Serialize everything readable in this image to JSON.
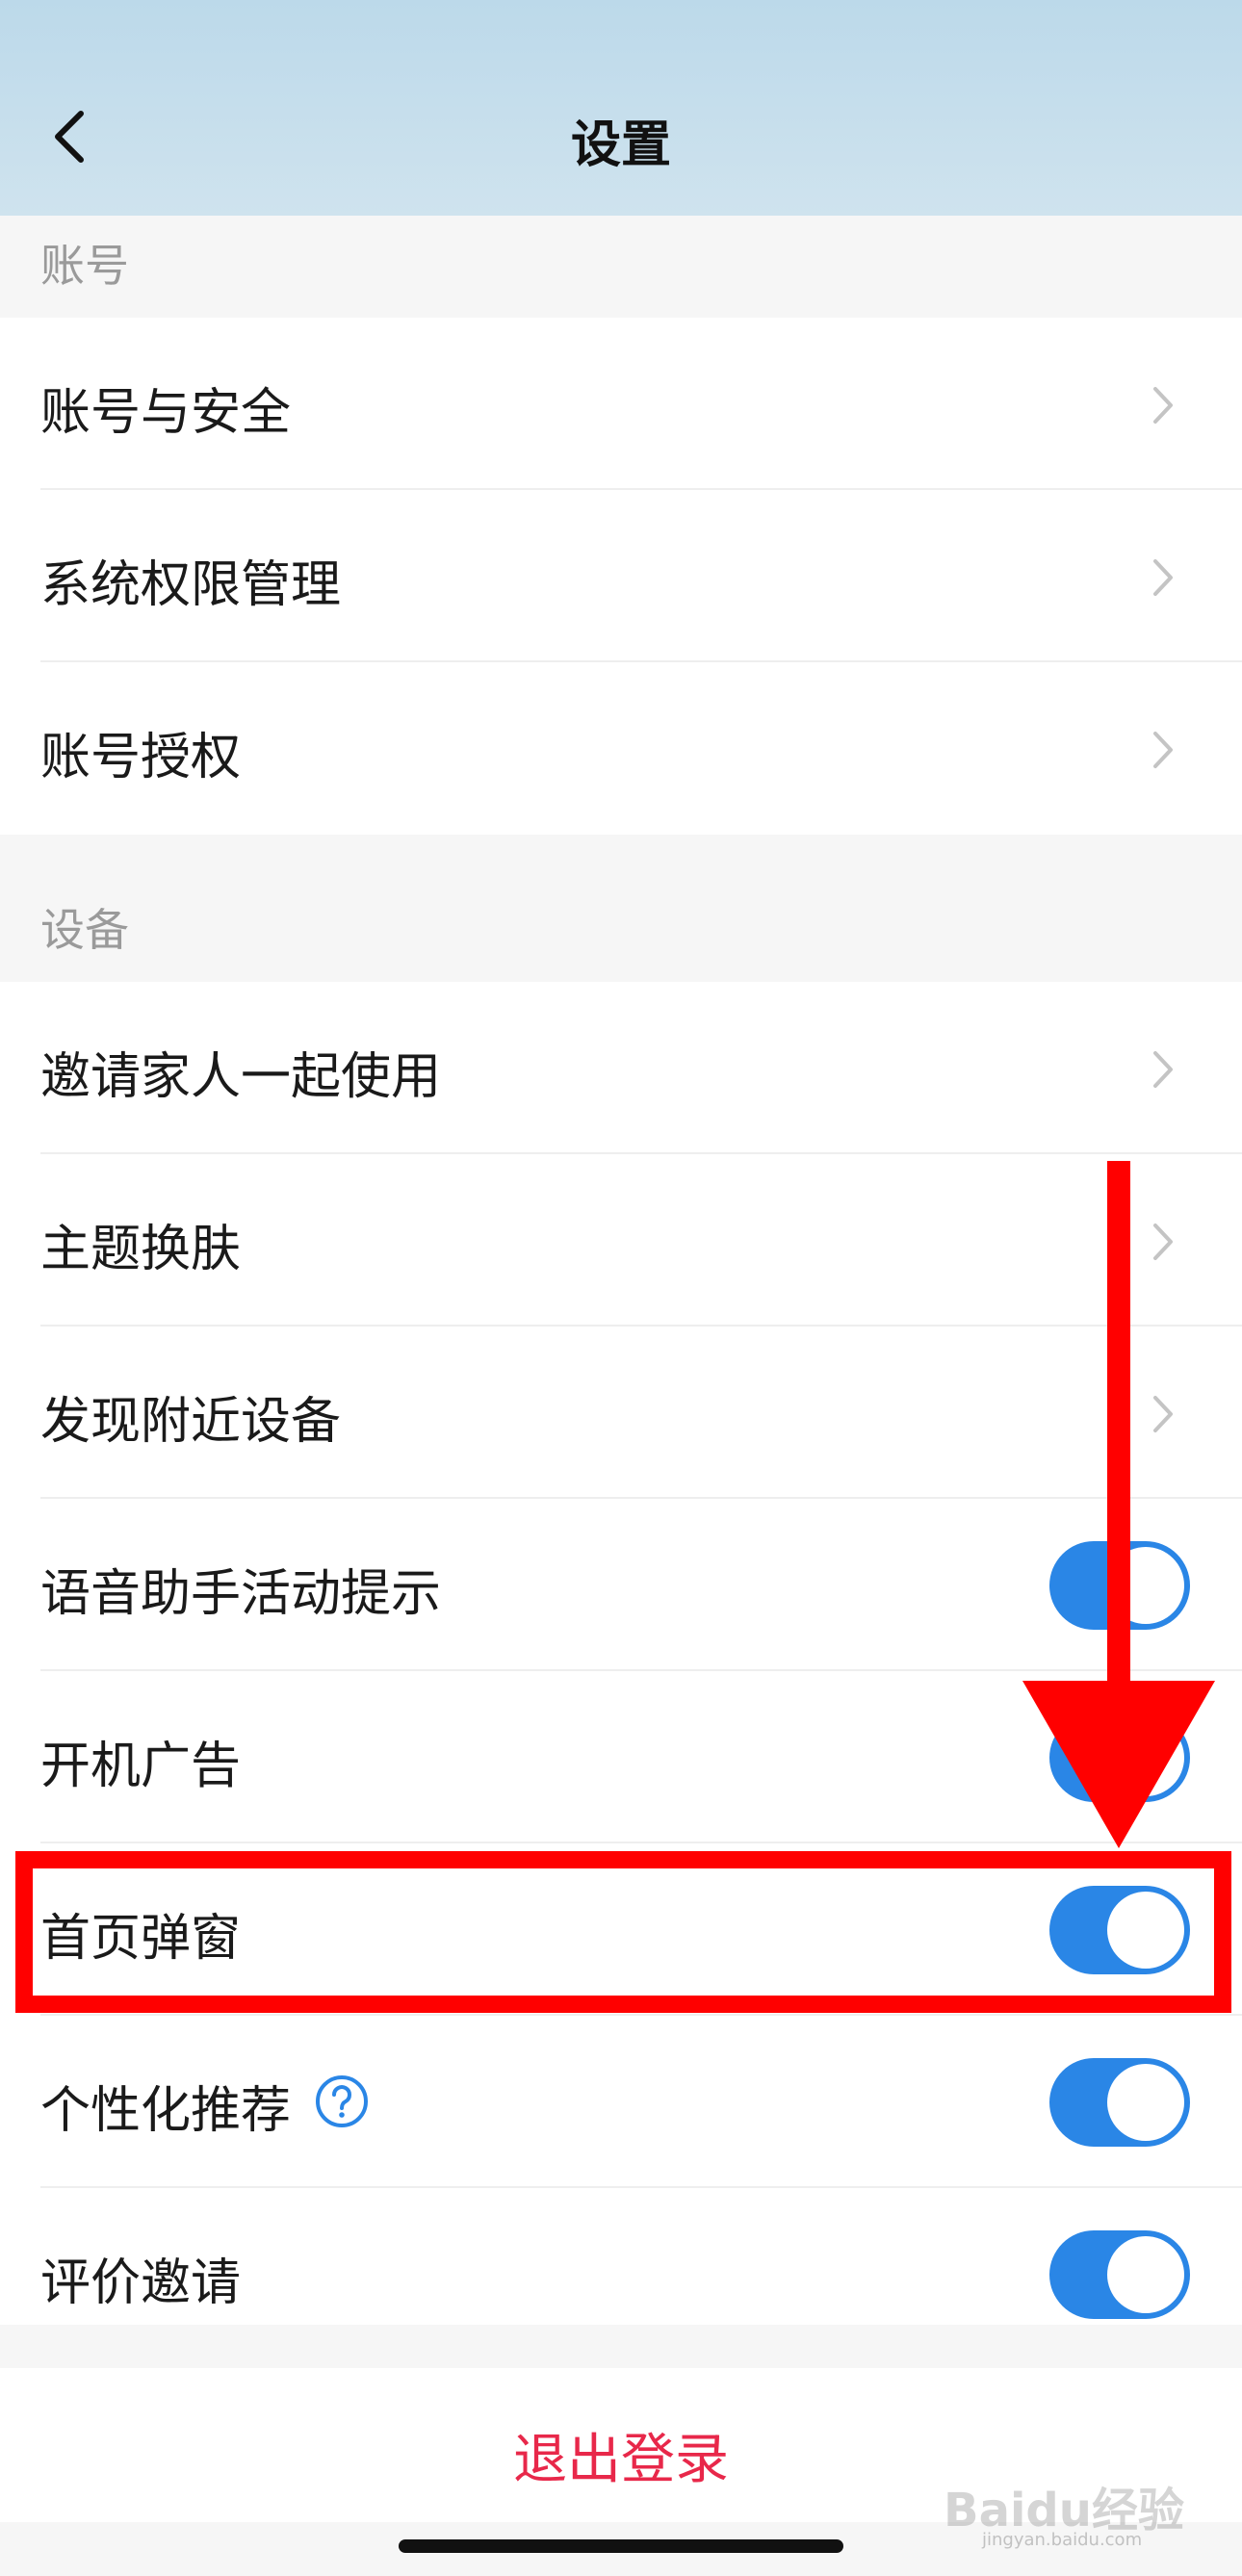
{
  "header": {
    "title": "设置"
  },
  "sections": {
    "account": {
      "label": "账号",
      "items": [
        {
          "label": "账号与安全"
        },
        {
          "label": "系统权限管理"
        },
        {
          "label": "账号授权"
        }
      ]
    },
    "device": {
      "label": "设备",
      "items": [
        {
          "label": "邀请家人一起使用"
        },
        {
          "label": "主题换肤"
        },
        {
          "label": "发现附近设备"
        },
        {
          "label": "语音助手活动提示",
          "toggle_on": true
        },
        {
          "label": "开机广告",
          "toggle_on": true
        },
        {
          "label": "首页弹窗",
          "toggle_on": true
        },
        {
          "label": "个性化推荐",
          "toggle_on": true
        },
        {
          "label": "评价邀请",
          "toggle_on": true
        }
      ]
    }
  },
  "logout": {
    "label": "退出登录"
  },
  "watermark": {
    "text": "Baidu经验",
    "subtext": "jingyan.baidu.com"
  },
  "colors": {
    "accent": "#2a86e6",
    "danger": "#e8284a",
    "annotation": "#ff0000"
  }
}
